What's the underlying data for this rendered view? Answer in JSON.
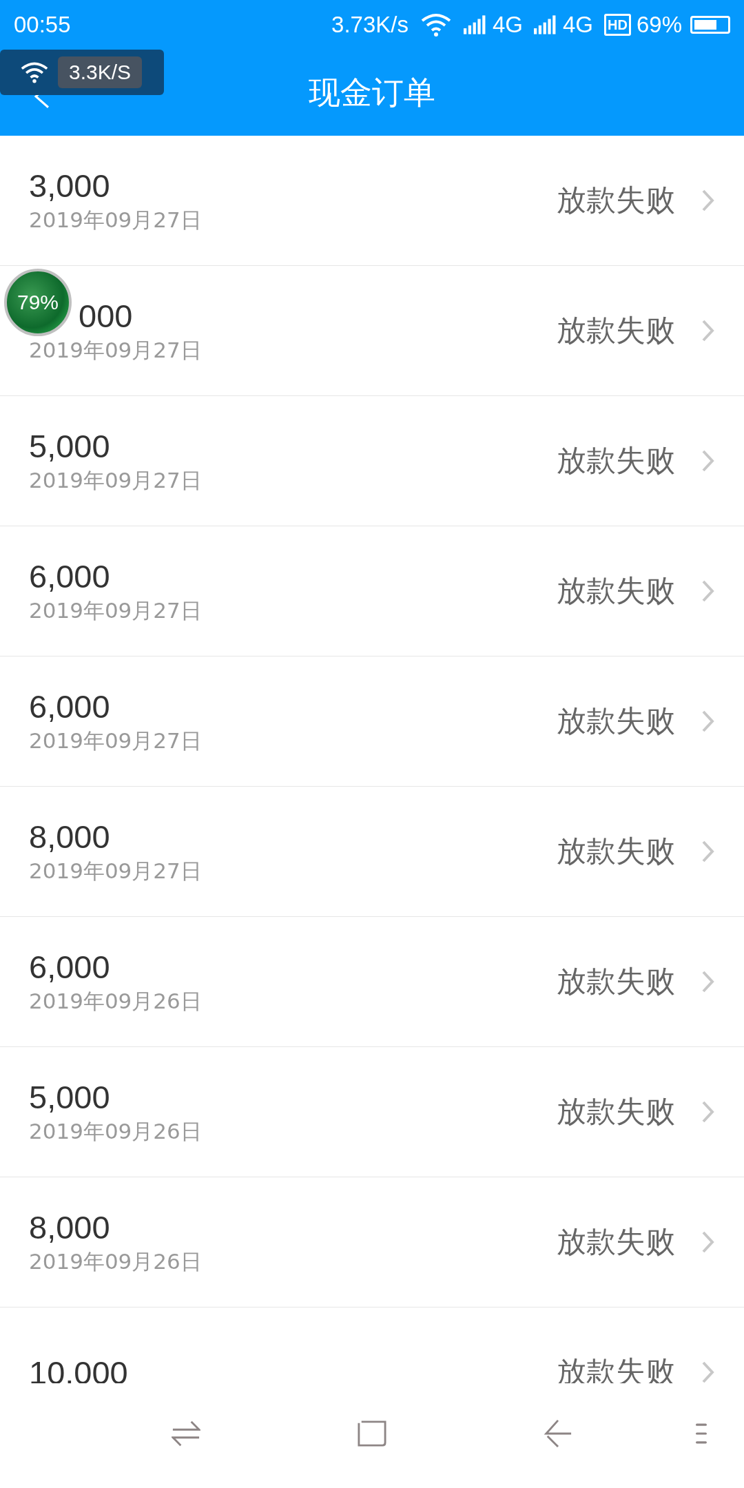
{
  "status_bar": {
    "time": "00:55",
    "speed": "3.73K/s",
    "networks": [
      "4G",
      "4G"
    ],
    "hd": "HD",
    "battery": "69%"
  },
  "app_bar": {
    "title": "现金订单"
  },
  "floating_speed": {
    "speed": "3.3K/S"
  },
  "floating_meter": {
    "reading": "79%"
  },
  "orders": [
    {
      "amount": "3,000",
      "date": "2019年09月27日",
      "status": "放款失败"
    },
    {
      "amount": "000",
      "date": "2019年09月27日",
      "status": "放款失败",
      "partial": true
    },
    {
      "amount": "5,000",
      "date": "2019年09月27日",
      "status": "放款失败"
    },
    {
      "amount": "6,000",
      "date": "2019年09月27日",
      "status": "放款失败"
    },
    {
      "amount": "6,000",
      "date": "2019年09月27日",
      "status": "放款失败"
    },
    {
      "amount": "8,000",
      "date": "2019年09月27日",
      "status": "放款失败"
    },
    {
      "amount": "6,000",
      "date": "2019年09月26日",
      "status": "放款失败"
    },
    {
      "amount": "5,000",
      "date": "2019年09月26日",
      "status": "放款失败"
    },
    {
      "amount": "8,000",
      "date": "2019年09月26日",
      "status": "放款失败"
    },
    {
      "amount": "10,000",
      "status": "放款失败"
    }
  ]
}
